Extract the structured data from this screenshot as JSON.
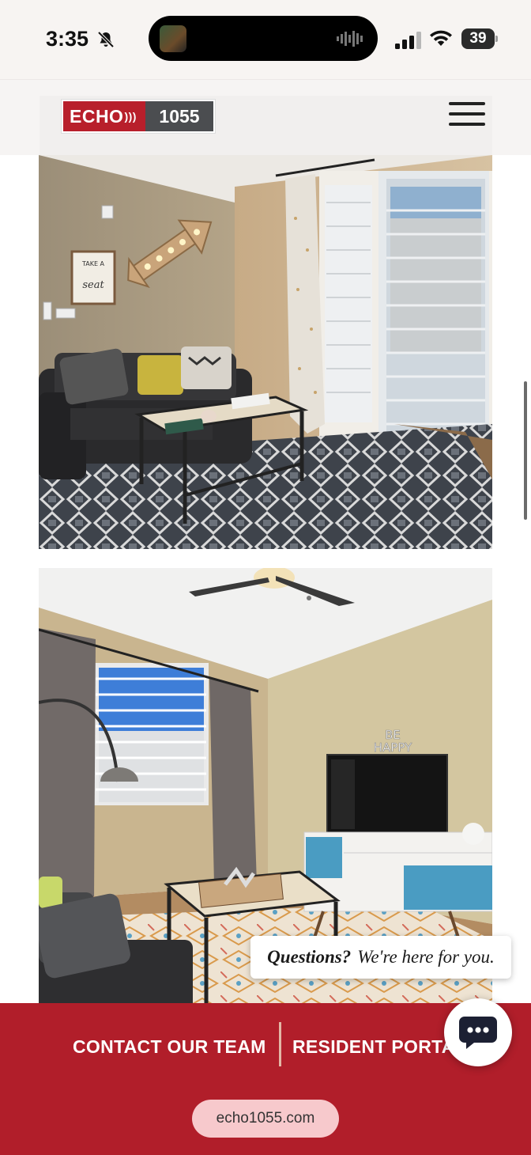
{
  "status_bar": {
    "time": "3:35",
    "battery": "39",
    "icons": [
      "bell-muted-icon",
      "signal-icon",
      "wifi-icon",
      "battery-icon"
    ]
  },
  "header": {
    "logo_left": "ECHO",
    "logo_right": "1055",
    "menu_icon": "hamburger-menu-icon"
  },
  "gallery": {
    "photos": [
      {
        "kind": "photo",
        "subject": "living room with leather sofa and balcony door"
      },
      {
        "kind": "photo",
        "subject": "living room with TV stand and window"
      }
    ],
    "photo1_wall_text": [
      "TAKE A",
      "seat"
    ],
    "photo2_wall_text": [
      "BE",
      "HAPPY"
    ]
  },
  "chat": {
    "question_bold": "Questions?",
    "question_rest": "We're here for you.",
    "chat_icon": "chat-bubble-icon"
  },
  "footer": {
    "contact_label": "CONTACT OUR TEAM",
    "resident_label": "RESIDENT PORTAL",
    "url": "echo1055.com"
  },
  "colors": {
    "brand_red": "#b11e2a",
    "logo_gray": "#4b4d50",
    "url_pill": "#f7c9cc"
  }
}
